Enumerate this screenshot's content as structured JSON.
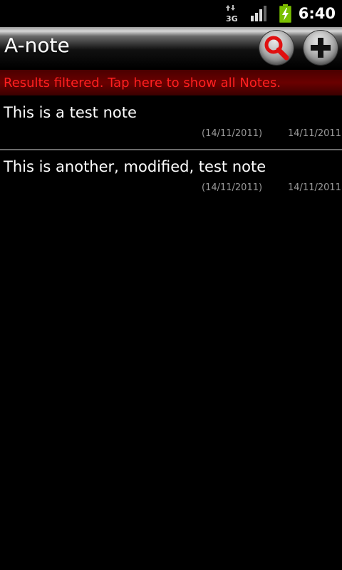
{
  "status_bar": {
    "network_icon": "3g-icon",
    "network_label": "3G",
    "signal_icon": "signal-bars-icon",
    "signal_level": 0.75,
    "battery_icon": "battery-charging-icon",
    "time": "6:40"
  },
  "header": {
    "title": "A-note",
    "search_icon": "search-icon",
    "add_icon": "add-icon"
  },
  "filter_banner": {
    "text": "Results filtered. Tap here to show all Notes."
  },
  "notes": [
    {
      "title": "This is a test note",
      "created": "(14/11/2011)",
      "modified": "14/11/2011"
    },
    {
      "title": "This is another, modified, test note",
      "created": "(14/11/2011)",
      "modified": "14/11/2011"
    }
  ],
  "colors": {
    "banner_text": "#ff2020",
    "banner_bg": "#6a0000",
    "search_icon": "#e01010",
    "battery_fill": "#7ac000"
  }
}
